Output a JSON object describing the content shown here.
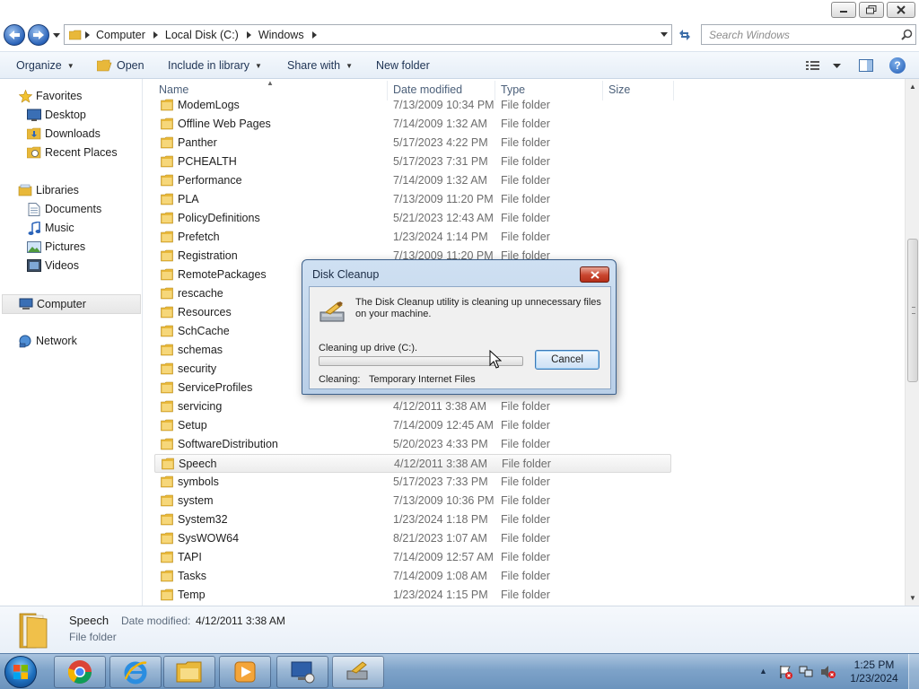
{
  "address": {
    "crumbs": [
      "Computer",
      "Local Disk (C:)",
      "Windows"
    ],
    "search_placeholder": "Search Windows"
  },
  "toolbar": {
    "organize": "Organize",
    "open": "Open",
    "include_in_library": "Include in library",
    "share_with": "Share with",
    "new_folder": "New folder"
  },
  "nav": {
    "favorites": "Favorites",
    "desktop": "Desktop",
    "downloads": "Downloads",
    "recent_places": "Recent Places",
    "libraries": "Libraries",
    "documents": "Documents",
    "music": "Music",
    "pictures": "Pictures",
    "videos": "Videos",
    "computer": "Computer",
    "network": "Network"
  },
  "columns": {
    "name": "Name",
    "date_modified": "Date modified",
    "type": "Type",
    "size": "Size"
  },
  "files": [
    {
      "name": "ModemLogs",
      "date": "7/13/2009 10:34 PM",
      "type": "File folder"
    },
    {
      "name": "Offline Web Pages",
      "date": "7/14/2009 1:32 AM",
      "type": "File folder"
    },
    {
      "name": "Panther",
      "date": "5/17/2023 4:22 PM",
      "type": "File folder"
    },
    {
      "name": "PCHEALTH",
      "date": "5/17/2023 7:31 PM",
      "type": "File folder"
    },
    {
      "name": "Performance",
      "date": "7/14/2009 1:32 AM",
      "type": "File folder"
    },
    {
      "name": "PLA",
      "date": "7/13/2009 11:20 PM",
      "type": "File folder"
    },
    {
      "name": "PolicyDefinitions",
      "date": "5/21/2023 12:43 AM",
      "type": "File folder"
    },
    {
      "name": "Prefetch",
      "date": "1/23/2024 1:14 PM",
      "type": "File folder"
    },
    {
      "name": "Registration",
      "date": "7/13/2009 11:20 PM",
      "type": "File folder"
    },
    {
      "name": "RemotePackages",
      "date": "",
      "type": ""
    },
    {
      "name": "rescache",
      "date": "",
      "type": ""
    },
    {
      "name": "Resources",
      "date": "",
      "type": ""
    },
    {
      "name": "SchCache",
      "date": "",
      "type": ""
    },
    {
      "name": "schemas",
      "date": "",
      "type": ""
    },
    {
      "name": "security",
      "date": "",
      "type": ""
    },
    {
      "name": "ServiceProfiles",
      "date": "",
      "type": ""
    },
    {
      "name": "servicing",
      "date": "4/12/2011 3:38 AM",
      "type": "File folder"
    },
    {
      "name": "Setup",
      "date": "7/14/2009 12:45 AM",
      "type": "File folder"
    },
    {
      "name": "SoftwareDistribution",
      "date": "5/20/2023 4:33 PM",
      "type": "File folder"
    },
    {
      "name": "Speech",
      "date": "4/12/2011 3:38 AM",
      "type": "File folder"
    },
    {
      "name": "symbols",
      "date": "5/17/2023 7:33 PM",
      "type": "File folder"
    },
    {
      "name": "system",
      "date": "7/13/2009 10:36 PM",
      "type": "File folder"
    },
    {
      "name": "System32",
      "date": "1/23/2024 1:18 PM",
      "type": "File folder"
    },
    {
      "name": "SysWOW64",
      "date": "8/21/2023 1:07 AM",
      "type": "File folder"
    },
    {
      "name": "TAPI",
      "date": "7/14/2009 12:57 AM",
      "type": "File folder"
    },
    {
      "name": "Tasks",
      "date": "7/14/2009 1:08 AM",
      "type": "File folder"
    },
    {
      "name": "Temp",
      "date": "1/23/2024 1:15 PM",
      "type": "File folder"
    }
  ],
  "selected_file_index": 19,
  "details": {
    "name": "Speech",
    "modified_label": "Date modified:",
    "modified_value": "4/12/2011 3:38 AM",
    "type": "File folder"
  },
  "dialog": {
    "title": "Disk Cleanup",
    "message": "The Disk Cleanup utility is cleaning up unnecessary files on your machine.",
    "drive_label": "Cleaning up drive  (C:).",
    "progress_fraction": 0.0,
    "cancel_label": "Cancel",
    "status_label": "Cleaning:",
    "status_value": "Temporary Internet Files"
  },
  "clock": {
    "time": "1:25 PM",
    "date": "1/23/2024"
  },
  "colors": {
    "folder": "#e8b83a",
    "accent": "#2a63b9"
  }
}
